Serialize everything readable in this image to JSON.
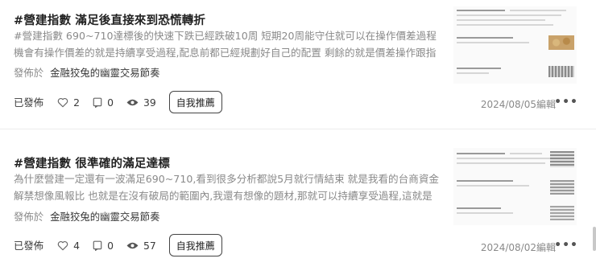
{
  "posts": [
    {
      "title": "#營建指數 滿足後直接來到恐慌轉折",
      "excerpt": "#營建指數 690~710達標後的快速下跌已經跌破10周 短期20周能守住就可以在操作價差過程機會有操作價差的就是持續享受過程,配息前都已經規劃好自己的配置 剩餘的就是價差操作跟指數的...",
      "published_in_label": "發佈於",
      "column_name": "金融狡兔的幽靈交易節奏",
      "status": "已發佈",
      "likes": "2",
      "comments": "0",
      "views": "39",
      "recommend_label": "自我推薦",
      "date": "2024/08/05編輯",
      "more_label": "•••",
      "thumb_image_color": "#c9a26a"
    },
    {
      "title": "#營建指數 很準確的滿足達標",
      "excerpt": "為什麼營建一定還有一波滿足690~710,看到很多分析都說5月就行情結束 就是我看的台商資金解禁想像風報比 也就是在沒有破局的範圍內,我還有想像的題材,那就可以持續享受過程,這就是投資...",
      "published_in_label": "發佈於",
      "column_name": "金融狡兔的幽靈交易節奏",
      "status": "已發佈",
      "likes": "4",
      "comments": "0",
      "views": "57",
      "recommend_label": "自我推薦",
      "date": "2024/08/02編輯",
      "more_label": "•••",
      "thumb_image_color": "#8c8c8c"
    }
  ],
  "icons": {
    "like": "heart-icon",
    "comment": "comment-icon",
    "view": "eye-icon",
    "more": "more-dots-icon"
  }
}
